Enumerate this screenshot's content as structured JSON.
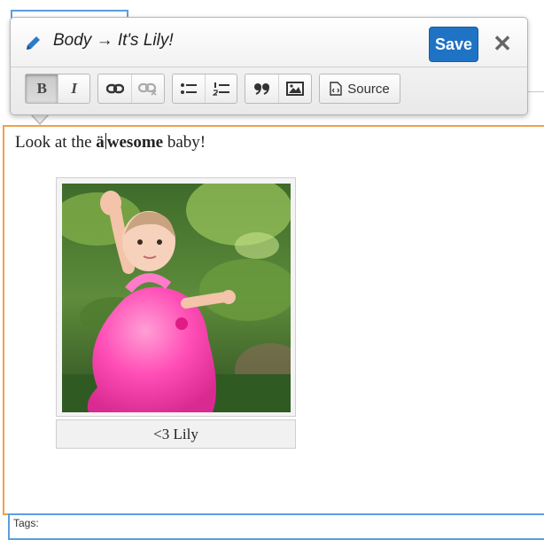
{
  "toolbar": {
    "title": "Body → It's Lily!",
    "save_label": "Save",
    "close_symbol": "✕",
    "buttons": {
      "bold": "B",
      "italic": "I",
      "blockquote": "❞❞",
      "source": "Source"
    },
    "icons": [
      "pencil-icon",
      "bold-icon",
      "italic-icon",
      "link-icon",
      "unlink-icon",
      "bulleted-list-icon",
      "numbered-list-icon",
      "blockquote-icon",
      "image-icon",
      "source-icon"
    ],
    "accent_color": "#1f73c4"
  },
  "content": {
    "text_before": "Look at the ",
    "text_strong_a": "ä",
    "text_strong_b": "wesome",
    "text_after": " baby!",
    "caption": "<3 Lily"
  },
  "tags": {
    "label": "Tags:"
  }
}
